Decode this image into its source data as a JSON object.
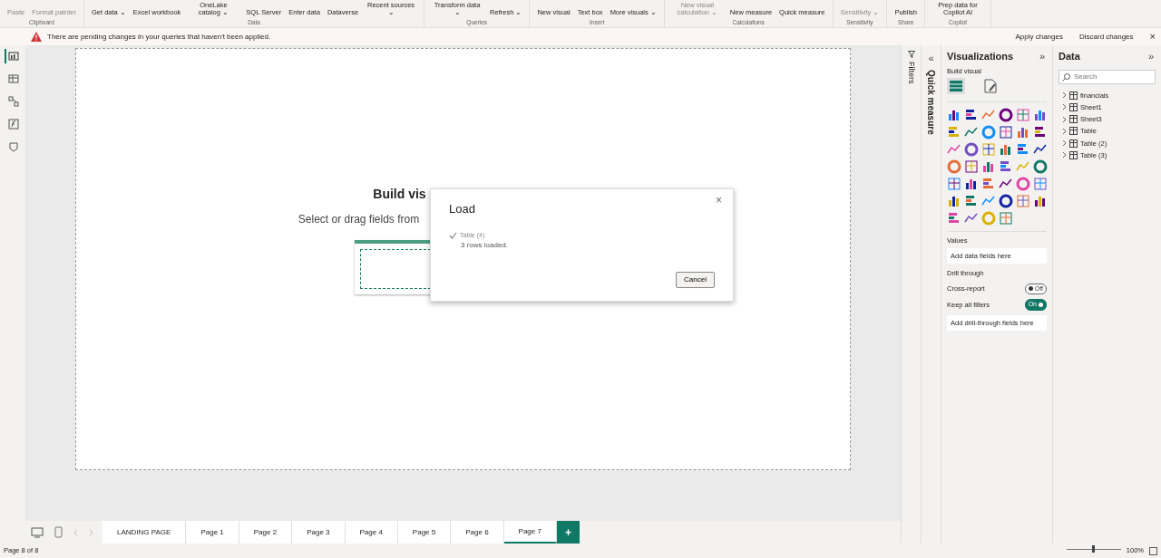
{
  "ribbon": {
    "groups": [
      {
        "label": "Clipboard",
        "buttons": [
          {
            "label": "Paste",
            "disabled": true
          },
          {
            "label": "Format painter",
            "disabled": true
          }
        ]
      },
      {
        "label": "Data",
        "buttons": [
          {
            "label": "Get data ⌄",
            "disabled": false
          },
          {
            "label": "Excel workbook",
            "disabled": false
          },
          {
            "label": "OneLake catalog ⌄",
            "disabled": false
          },
          {
            "label": "SQL Server",
            "disabled": false
          },
          {
            "label": "Enter data",
            "disabled": false
          },
          {
            "label": "Dataverse",
            "disabled": false
          },
          {
            "label": "Recent sources ⌄",
            "disabled": false
          }
        ]
      },
      {
        "label": "Queries",
        "buttons": [
          {
            "label": "Transform data ⌄",
            "disabled": false
          },
          {
            "label": "Refresh ⌄",
            "disabled": false
          }
        ]
      },
      {
        "label": "Insert",
        "buttons": [
          {
            "label": "New visual",
            "disabled": false
          },
          {
            "label": "Text box",
            "disabled": false
          },
          {
            "label": "More visuals ⌄",
            "disabled": false
          }
        ]
      },
      {
        "label": "Calculations",
        "buttons": [
          {
            "label": "New visual calculation ⌄",
            "disabled": true
          },
          {
            "label": "New measure",
            "disabled": false
          },
          {
            "label": "Quick measure",
            "disabled": false
          }
        ]
      },
      {
        "label": "Sensitivity",
        "buttons": [
          {
            "label": "Sensitivity ⌄",
            "disabled": true
          }
        ]
      },
      {
        "label": "Share",
        "buttons": [
          {
            "label": "Publish",
            "disabled": false
          }
        ]
      },
      {
        "label": "Copilot",
        "buttons": [
          {
            "label": "Prep data for Copilot AI",
            "disabled": false
          }
        ]
      }
    ]
  },
  "notification": {
    "message": "There are pending changes in your queries that haven't been applied.",
    "actions": [
      "Apply changes",
      "Discard changes"
    ],
    "close": "×"
  },
  "left_rail": [
    {
      "kind": "report",
      "selected": true
    },
    {
      "kind": "table",
      "selected": false
    },
    {
      "kind": "model",
      "selected": false
    },
    {
      "kind": "dax",
      "selected": false
    },
    {
      "kind": "query",
      "selected": false
    }
  ],
  "canvas": {
    "placeholder_title": "Build vis",
    "placeholder_text": "Select or drag fields from"
  },
  "dialog": {
    "title": "Load",
    "close": "×",
    "item": "Table (4)",
    "status": "3 rows loaded.",
    "button": "Cancel"
  },
  "filters_strip": {
    "label": "Filters"
  },
  "quick_measure_strip": {
    "label": "Quick measure",
    "collapse": "«"
  },
  "visualizations": {
    "title": "Visualizations",
    "expand": "»",
    "subtitle": "Build visual",
    "sections": [
      {
        "kind": "well",
        "label": "Values",
        "placeholder": "Add data fields here"
      },
      {
        "kind": "heading",
        "label": "Drill through"
      },
      {
        "kind": "toggle",
        "label": "Cross-report",
        "on": false,
        "text": "Off"
      },
      {
        "kind": "toggle",
        "label": "Keep all filters",
        "on": true,
        "text": "On"
      },
      {
        "kind": "well",
        "placeholder": "Add drill-through fields here"
      }
    ]
  },
  "data_pane": {
    "title": "Data",
    "expand": "»",
    "search": {
      "placeholder": "Search"
    },
    "tables": [
      "financials",
      "Sheet1",
      "Sheet3",
      "Table",
      "Table (2)",
      "Table (3)"
    ]
  },
  "page_tabs": [
    {
      "label": "LANDING PAGE",
      "selected": false
    },
    {
      "label": "Page 1",
      "selected": false
    },
    {
      "label": "Page 2",
      "selected": false
    },
    {
      "label": "Page 3",
      "selected": false
    },
    {
      "label": "Page 4",
      "selected": false
    },
    {
      "label": "Page 5",
      "selected": false
    },
    {
      "label": "Page 6",
      "selected": false
    },
    {
      "label": "Page 7",
      "selected": true
    }
  ],
  "add_page": "+",
  "status_bar": {
    "page": "Page 8 of 8",
    "zoom": "100%",
    "zoom_slider": {
      "level": 0.5
    }
  }
}
